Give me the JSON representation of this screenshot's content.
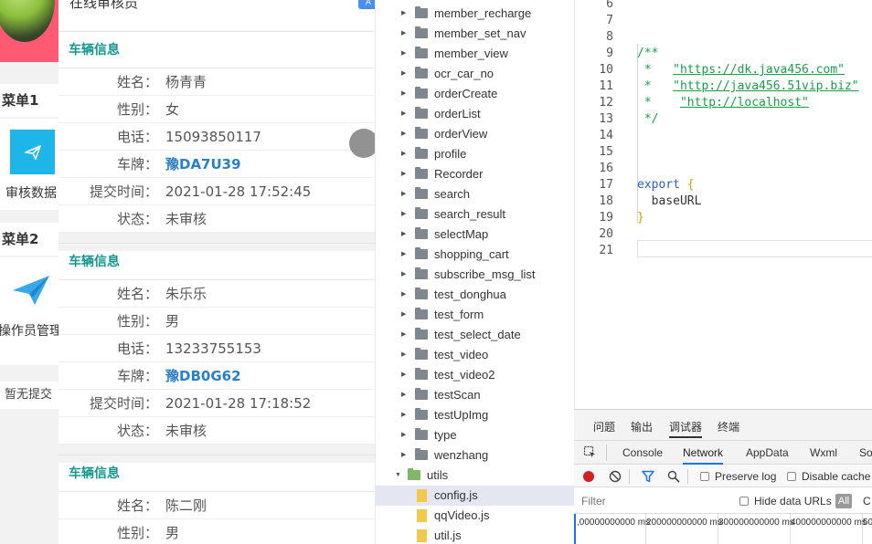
{
  "simulator": {
    "header_cutoff": "在线审核员",
    "header_button": "A",
    "menu1": {
      "title": "菜单1",
      "item_label": "审核数据"
    },
    "menu2": {
      "title": "菜单2",
      "item_label": "操作员管理"
    },
    "empty_text": "暂无提交",
    "cards": [
      {
        "title": "车辆信息",
        "rows": [
          {
            "key": "姓名：",
            "value": "杨青青"
          },
          {
            "key": "性别：",
            "value": "女"
          },
          {
            "key": "电话：",
            "value": "15093850117"
          },
          {
            "key": "车牌：",
            "value": "豫DA7U39",
            "highlight": true
          },
          {
            "key": "提交时间：",
            "value": "2021-01-28 17:52:45"
          },
          {
            "key": "状态：",
            "value": "未审核"
          }
        ]
      },
      {
        "title": "车辆信息",
        "rows": [
          {
            "key": "姓名：",
            "value": "朱乐乐"
          },
          {
            "key": "性别：",
            "value": "男"
          },
          {
            "key": "电话：",
            "value": "13233755153"
          },
          {
            "key": "车牌：",
            "value": "豫DB0G62",
            "highlight": true
          },
          {
            "key": "提交时间：",
            "value": "2021-01-28 17:18:52"
          },
          {
            "key": "状态：",
            "value": "未审核"
          }
        ]
      },
      {
        "title": "车辆信息",
        "rows": [
          {
            "key": "姓名：",
            "value": "陈二刚"
          },
          {
            "key": "性别：",
            "value": "男"
          }
        ]
      }
    ]
  },
  "file_tree": {
    "folders": [
      "member_recharge",
      "member_set_nav",
      "member_view",
      "ocr_car_no",
      "orderCreate",
      "orderList",
      "orderView",
      "profile",
      "Recorder",
      "search",
      "search_result",
      "selectMap",
      "shopping_cart",
      "subscribe_msg_list",
      "test_donghua",
      "test_form",
      "test_select_date",
      "test_video",
      "test_video2",
      "testScan",
      "testUpImg",
      "type",
      "wenzhang"
    ],
    "open_folder": "utils",
    "files": [
      "config.js",
      "qqVideo.js",
      "util.js"
    ],
    "selected_file": "config.js"
  },
  "editor": {
    "lines": [
      {
        "num": "6",
        "text": ""
      },
      {
        "num": "7",
        "text": ""
      },
      {
        "num": "8",
        "text": ""
      },
      {
        "num": "9",
        "text": "/**"
      },
      {
        "num": "10",
        "text": " *   \"https://dk.java456.com\""
      },
      {
        "num": "11",
        "text": " *   \"http://java456.51vip.biz\""
      },
      {
        "num": "12",
        "text": " *    \"http://localhost\""
      },
      {
        "num": "13",
        "text": " */"
      },
      {
        "num": "14",
        "text": ""
      },
      {
        "num": "15",
        "text": ""
      },
      {
        "num": "16",
        "text": ""
      },
      {
        "num": "17",
        "text": "export {"
      },
      {
        "num": "18",
        "text": "  baseURL"
      },
      {
        "num": "19",
        "text": "}"
      },
      {
        "num": "20",
        "text": ""
      },
      {
        "num": "21",
        "text": ""
      }
    ]
  },
  "devtools": {
    "top_tabs": [
      "问题",
      "输出",
      "调试器",
      "终端"
    ],
    "active_top_tab": "调试器",
    "tabs": [
      "Console",
      "Network",
      "AppData",
      "Wxml",
      "So"
    ],
    "active_tab": "Network",
    "preserve_log": "Preserve log",
    "disable_cache": "Disable cache",
    "filter_placeholder": "Filter",
    "hide_data_urls": "Hide data URLs",
    "all_button": "All",
    "cut_text": "C",
    "timeline_ticks": [
      ",00000000000 ms",
      "200000000000 ms",
      "300000000000 ms",
      "400000000000 ms",
      "50"
    ]
  },
  "colors": {
    "accent_teal": "#15978e",
    "plate_blue": "#2b7fc5",
    "icon_blue": "#1eb6e8",
    "record_red": "#d32020"
  }
}
